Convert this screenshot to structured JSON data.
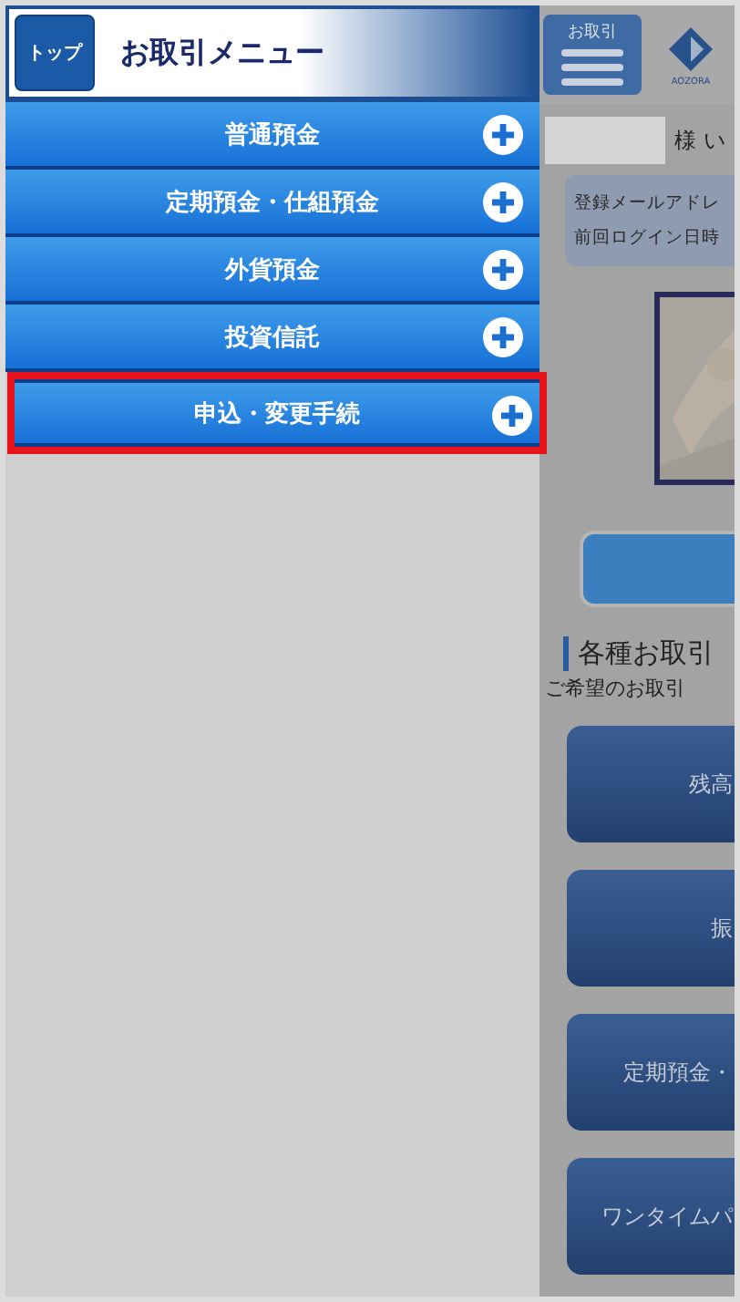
{
  "drawer": {
    "top_button": "トップ",
    "title": "お取引メニュー",
    "items": [
      {
        "label": "普通預金",
        "highlighted": false
      },
      {
        "label": "定期預金・仕組預金",
        "highlighted": false
      },
      {
        "label": "外貨預金",
        "highlighted": false
      },
      {
        "label": "投資信託",
        "highlighted": false
      },
      {
        "label": "申込・変更手続",
        "highlighted": true
      }
    ]
  },
  "background_page": {
    "menu_button": "お取引",
    "logo_text": "AOZORA",
    "name_suffix": "様 い",
    "notice_lines": [
      "登録メールアドレ",
      "前回ログイン日時"
    ],
    "section_title": "各種お取引",
    "section_text": "ご希望のお取引",
    "buttons": [
      "残高",
      "振",
      "定期預金・",
      "ワンタイムパ"
    ]
  }
}
